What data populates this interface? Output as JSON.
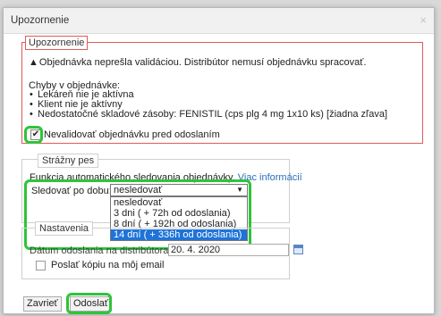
{
  "dialog": {
    "title": "Upozornenie",
    "close_glyph": "×"
  },
  "warning": {
    "legend": "Upozornenie",
    "message": "Objednávka neprešla validáciou. Distribútor nemusí objednávku spracovať.",
    "errors_title": "Chyby v objednávke:",
    "errors": [
      "Lekáreň nie je aktívna",
      "Klient nie je aktívny",
      "Nedostatočné skladové zásoby: FENISTIL (cps plg 4 mg 1x10 ks) [žiadna zľava]"
    ],
    "checkbox_label": "Nevalidovať objednávku pred odoslaním",
    "checkbox_checked": true
  },
  "watchdog": {
    "legend": "Strážny pes",
    "description": "Funkcia automatického sledovania objednávky.",
    "more_info_link": "Viac informácií",
    "follow_label": "Sledovať po dobu:",
    "selected_value": "nesledovať",
    "options": [
      "nesledovať",
      "3 dni ( + 72h od odoslania)",
      "8 dní ( + 192h od odoslania)",
      "14 dní ( + 336h od odoslania)"
    ],
    "highlighted_option_index": 3
  },
  "settings": {
    "legend": "Nastavenia",
    "date_label": "Dátum odoslania na distribútora",
    "date_value": "20. 4. 2020",
    "copy_label": "Poslať kópiu na môj email"
  },
  "buttons": {
    "close": "Zavrieť",
    "send": "Odoslať"
  },
  "icons": {
    "warning": "warning-icon",
    "close": "close-icon",
    "calendar": "calendar-icon",
    "dropdown": "chevron-down-icon"
  },
  "colors": {
    "warning_border": "#e05a5a",
    "highlight_ring": "#2ec43a",
    "selected_option": "#1e73d8",
    "link": "#2a6ebd"
  }
}
